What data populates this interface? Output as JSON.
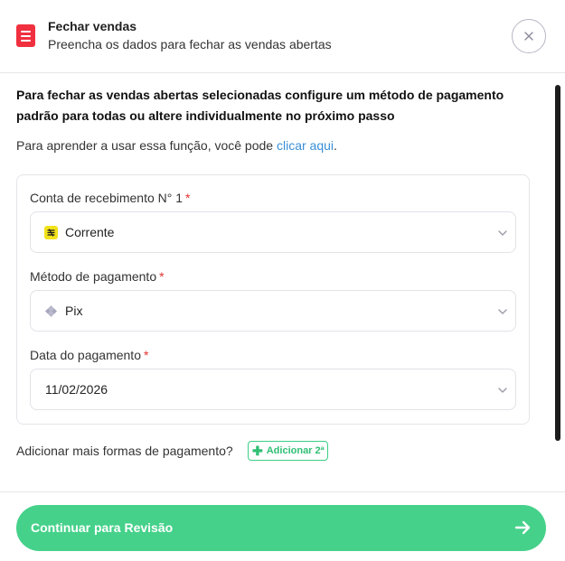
{
  "header": {
    "title": "Fechar vendas",
    "subtitle": "Preencha os dados para fechar as vendas abertas",
    "icon": "document-icon",
    "close_icon": "close-icon"
  },
  "intro": {
    "bold_text": "Para fechar as vendas abertas selecionadas configure um método de pagamento padrão para todas ou altere individualmente no próximo passo",
    "help_prefix": "Para aprender a usar essa função, você pode ",
    "help_link": "clicar aqui",
    "help_suffix": "."
  },
  "form": {
    "account": {
      "label": "Conta de recebimento N° 1",
      "required": "*",
      "value": "Corrente",
      "icon": "bank-icon"
    },
    "method": {
      "label": "Método de pagamento",
      "required": "*",
      "value": "Pix",
      "icon": "pix-icon"
    },
    "date": {
      "label": "Data do pagamento",
      "required": "*",
      "value": "11/02/2026"
    }
  },
  "add_payment": {
    "text": "Adicionar mais formas de pagamento?",
    "button_label": "Adicionar 2ª"
  },
  "footer": {
    "continue_label": "Continuar para Revisão",
    "arrow_icon": "arrow-right-icon"
  },
  "colors": {
    "accent_green": "#45d18a",
    "brand_red": "#f0303f",
    "link_blue": "#3a8fd9",
    "required_red": "#e53030"
  }
}
